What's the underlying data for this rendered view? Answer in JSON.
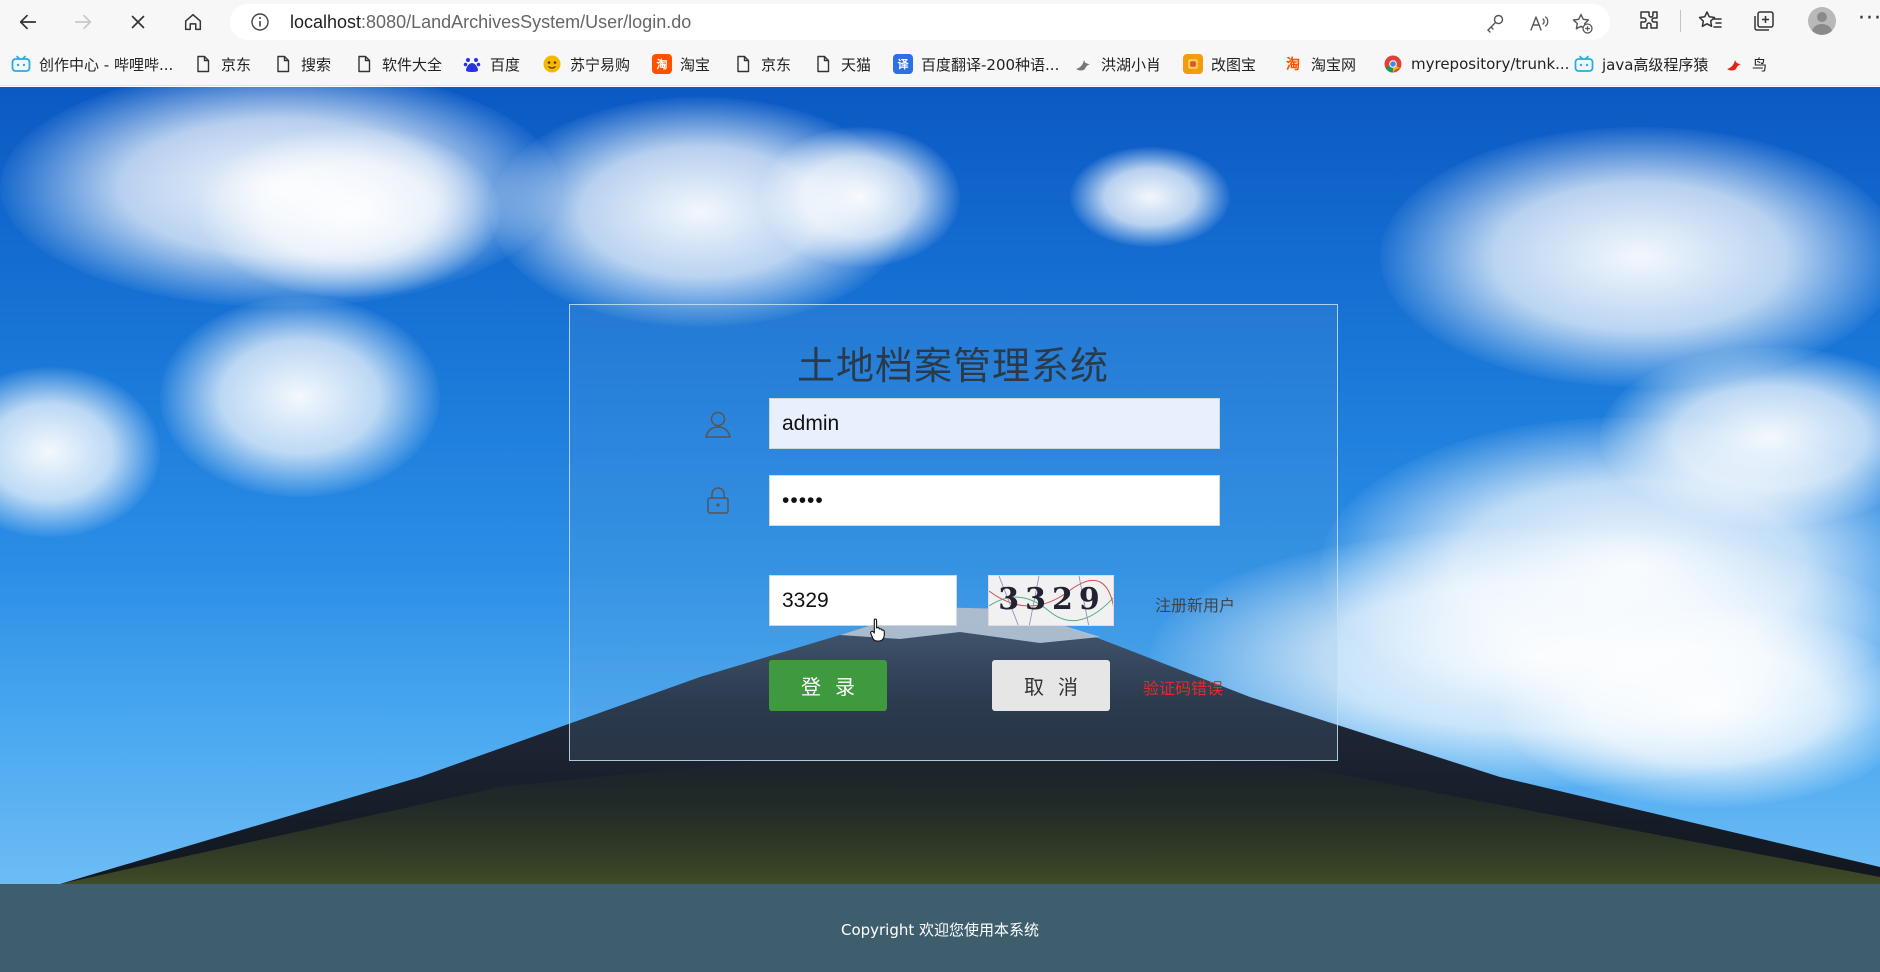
{
  "browser": {
    "url_host": "localhost",
    "url_rest": ":8080/LandArchivesSystem/User/login.do",
    "icons": [
      "back-icon",
      "forward-icon",
      "stop-icon",
      "home-icon",
      "info-icon",
      "key-icon",
      "read-aloud-icon",
      "favorite-add-icon",
      "extensions-icon",
      "favorites-icon",
      "collections-icon",
      "profile-icon",
      "more-icon"
    ]
  },
  "bookmarks": [
    {
      "label": "创作中心 - 哔哩哔...",
      "icon": "bilibili-icon",
      "color": "#23ade5"
    },
    {
      "label": "京东",
      "icon": "page-icon",
      "color": ""
    },
    {
      "label": "搜索",
      "icon": "page-icon",
      "color": ""
    },
    {
      "label": "软件大全",
      "icon": "page-icon",
      "color": ""
    },
    {
      "label": "百度",
      "icon": "baidu-icon",
      "color": "#2932e1"
    },
    {
      "label": "苏宁易购",
      "icon": "suning-icon",
      "color": "#f5b800"
    },
    {
      "label": "淘宝",
      "icon": "taobao-icon",
      "color": "#ff5000"
    },
    {
      "label": "京东",
      "icon": "page-icon",
      "color": ""
    },
    {
      "label": "天猫",
      "icon": "page-icon",
      "color": ""
    },
    {
      "label": "百度翻译-200种语...",
      "icon": "translate-icon",
      "color": "#2f6fe4"
    },
    {
      "label": "洪湖小肖",
      "icon": "bird-icon",
      "color": "#777777"
    },
    {
      "label": "改图宝",
      "icon": "gaitubao-icon",
      "color": "#f39c12"
    },
    {
      "label": "淘宝网",
      "icon": "taobao-icon",
      "color": "#ff5000"
    },
    {
      "label": "myrepository/trunk...",
      "icon": "chrome-icon",
      "color": "#4285f4"
    },
    {
      "label": "java高级程序猿",
      "icon": "bilibili-icon",
      "color": "#23ade5"
    },
    {
      "label": "鸟",
      "icon": "bird-icon",
      "color": "#e2231a"
    }
  ],
  "login": {
    "title": "土地档案管理系统",
    "username_value": "admin",
    "password_mask": "•••••",
    "captcha_input": "3329",
    "captcha_image_text": "3329",
    "register_link": "注册新用户",
    "login_button": "登录",
    "cancel_button": "取消",
    "error_message": "验证码错误"
  },
  "footer": {
    "text": "Copyright 欢迎您使用本系统"
  },
  "colors": {
    "login_button": "#3f9a3f",
    "footer_bg": "#3e5e6d",
    "error": "#e62a2a"
  }
}
